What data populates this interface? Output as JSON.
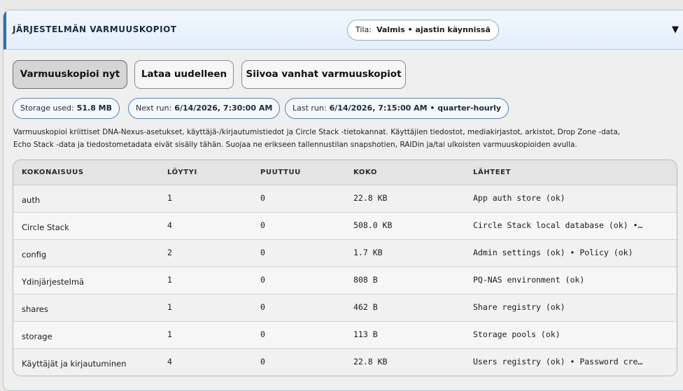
{
  "panel": {
    "title": "JÄRJESTELMÄN VARMUUSKOPIOT",
    "status_label": "Tila:",
    "status_value": "Valmis • ajastin käynnissä",
    "collapse_glyph": "▼"
  },
  "actions": {
    "backup_now": "Varmuuskopioi nyt",
    "reload": "Lataa uudelleen",
    "cleanup": "Siivoa vanhat varmuuskopiot"
  },
  "chips": {
    "storage_label": "Storage used:",
    "storage_value": "51.8 MB",
    "next_label": "Next run:",
    "next_value": "6/14/2026, 7:30:00 AM",
    "last_label": "Last run:",
    "last_value": "6/14/2026, 7:15:00 AM • quarter-hourly"
  },
  "description": {
    "line1": "Varmuuskopioi kriittiset DNA-Nexus-asetukset, käyttäjä-/kirjautumistiedot ja Circle Stack -tietokannat. Käyttäjien tiedostot, mediakirjastot, arkistot, Drop Zone -data,",
    "line2": "Echo Stack -data ja tiedostometadata eivät sisälly tähän. Suojaa ne erikseen tallennustilan snapshotien, RAIDin ja/tai ulkoisten varmuuskopioiden avulla."
  },
  "table": {
    "headers": {
      "name": "KOKONAISUUS",
      "found": "LÖYTYI",
      "missing": "PUUTTUU",
      "size": "KOKO",
      "sources": "LÄHTEET"
    },
    "rows": [
      {
        "name": "auth",
        "found": "1",
        "missing": "0",
        "size": "22.8 KB",
        "sources": "App auth store (ok)"
      },
      {
        "name": "Circle Stack",
        "found": "4",
        "missing": "0",
        "size": "508.0 KB",
        "sources": "Circle Stack local database (ok) •…"
      },
      {
        "name": "config",
        "found": "2",
        "missing": "0",
        "size": "1.7 KB",
        "sources": "Admin settings (ok) • Policy (ok)"
      },
      {
        "name": "Ydinjärjestelmä",
        "found": "1",
        "missing": "0",
        "size": "808 B",
        "sources": "PQ-NAS environment (ok)"
      },
      {
        "name": "shares",
        "found": "1",
        "missing": "0",
        "size": "462 B",
        "sources": "Share registry (ok)"
      },
      {
        "name": "storage",
        "found": "1",
        "missing": "0",
        "size": "113 B",
        "sources": "Storage pools (ok)"
      },
      {
        "name": "Käyttäjät ja kirjautuminen",
        "found": "4",
        "missing": "0",
        "size": "22.8 KB",
        "sources": "Users registry (ok) • Password cre…"
      }
    ]
  }
}
